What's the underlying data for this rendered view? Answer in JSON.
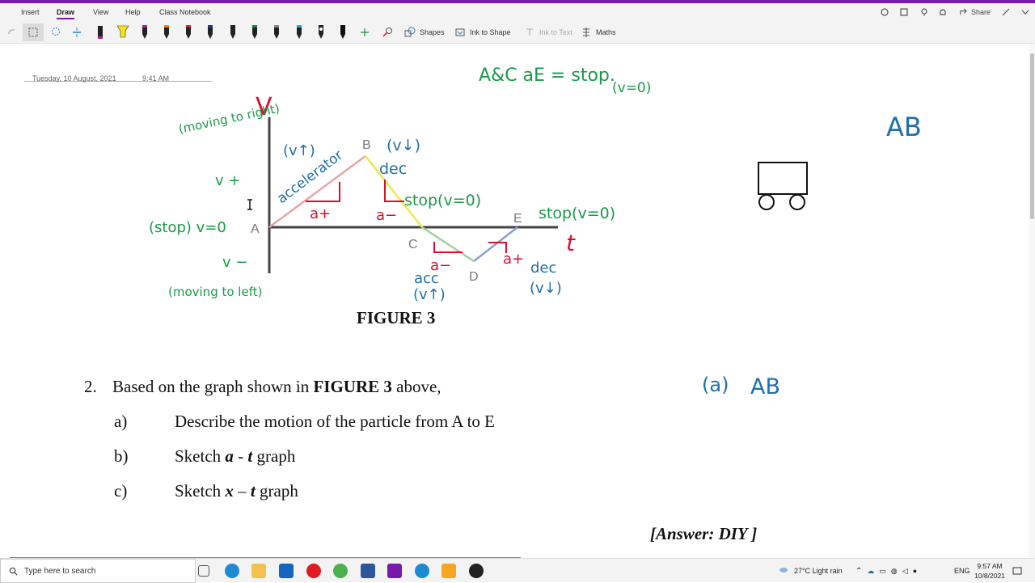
{
  "menu": {
    "tabs": [
      "Insert",
      "Draw",
      "View",
      "Help",
      "Class Notebook"
    ],
    "active": "Draw",
    "share": "Share"
  },
  "toolbar": {
    "shapes": "Shapes",
    "ink_to_shape": "Ink to Shape",
    "ink_to_text": "Ink to Text",
    "maths": "Maths",
    "pen_colors": [
      "#222222",
      "#f5e61a",
      "#b0228c",
      "#ff7f00",
      "#e0202a",
      "#1d3e8a",
      "#111111",
      "#1a8a3a",
      "#444444",
      "#27a8d8",
      "#222222",
      "#111111"
    ]
  },
  "page": {
    "date": "Tuesday, 10 August, 2021",
    "time": "9:41 AM"
  },
  "figure": {
    "caption": "FIGURE 3",
    "points": [
      "A",
      "B",
      "C",
      "D",
      "E"
    ]
  },
  "ink": {
    "v_axis": "V",
    "t_axis": "t",
    "moving_right": "(moving to right)",
    "v_plus": "v +",
    "stop_a": "(stop) v=0",
    "v_minus": "v −",
    "moving_left": "(moving to left)",
    "v_up": "(v↑)",
    "accelerate": "accelerator",
    "v_down_b": "(v↓)",
    "dec_b": "dec",
    "a_plus_1": "a+",
    "a_minus_1": "a−",
    "stop_c": "stop(v=0)",
    "stop_e": "stop(v=0)",
    "a_minus_2": "a−",
    "acc": "acc",
    "v_up_2": "(v↑)",
    "a_plus_2": "a+",
    "dec_2": "dec",
    "v_down_2": "(v↓)",
    "top_note_1": "A&C aE = stop.",
    "top_note_2": "(v=0)",
    "ab_right": "AB",
    "q_a_ink": "(a)",
    "q_a_ab": "AB"
  },
  "question": {
    "number": "2.",
    "intro_pre": "Based on the graph shown in ",
    "intro_bold": "FIGURE 3",
    "intro_post": " above,",
    "a_label": "a)",
    "a_text": "Describe the motion of the particle from A to E",
    "b_label": "b)",
    "b_pre": "Sketch ",
    "b_italic1": "a",
    "b_mid": " - ",
    "b_italic2": "t",
    "b_post": " graph",
    "c_label": "c)",
    "c_pre": "Sketch ",
    "c_italic1": "x",
    "c_mid": " – ",
    "c_italic2": "t",
    "c_post": " graph",
    "answer": "[Answer: DIY ]"
  },
  "taskbar": {
    "search_placeholder": "Type here to search",
    "weather": "27°C  Light rain",
    "lang": "ENG",
    "time": "9:57 AM",
    "date": "10/8/2021"
  },
  "colors": {
    "accent": "#7719aa",
    "ink_green": "#1a9a4a",
    "ink_blue": "#1f6fa8",
    "ink_red": "#d8102a"
  }
}
